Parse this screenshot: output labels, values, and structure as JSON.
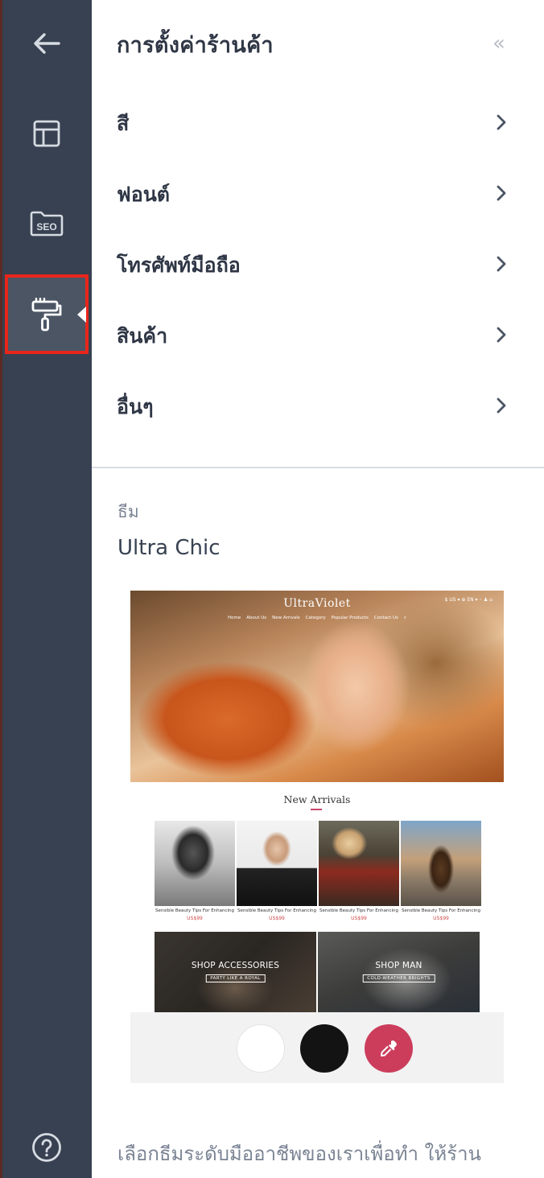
{
  "rail": {
    "items": [
      {
        "name": "back",
        "icon": "arrow-left-icon"
      },
      {
        "name": "layout",
        "icon": "layout-icon"
      },
      {
        "name": "seo",
        "icon": "seo-icon",
        "label": "SEO"
      },
      {
        "name": "design",
        "icon": "paint-roller-icon",
        "active": true
      },
      {
        "name": "help",
        "icon": "question-circle-icon"
      }
    ],
    "highlight_color": "#e8261b"
  },
  "panel": {
    "title": "การตั้งค่าร้านค้า",
    "collapse_label": "«",
    "menu": [
      {
        "label": "สี"
      },
      {
        "label": "ฟอนต์"
      },
      {
        "label": "โทรศัพท์มือถือ"
      },
      {
        "label": "สินค้า"
      },
      {
        "label": "อื่นๆ"
      }
    ]
  },
  "theme": {
    "caption": "ธีม",
    "name": "Ultra Chic",
    "preview": {
      "logo": "UltraViolet",
      "top_right": "$ US ▾   ⊕ EN ▾   ◦   ♟   ⌂",
      "nav": [
        "Home",
        "About Us",
        "New Arrivals",
        "Category",
        "Popular Products",
        "Contact Us"
      ],
      "section_title": "New Arrivals",
      "products": [
        {
          "name": "Sensible Beauty Tips For Enhancing",
          "price": "US$99"
        },
        {
          "name": "Sensible Beauty Tips For Enhancing",
          "price": "US$99"
        },
        {
          "name": "Sensible Beauty Tips For Enhancing",
          "price": "US$99"
        },
        {
          "name": "Sensible Beauty Tips For Enhancing",
          "price": "US$99"
        }
      ],
      "banners": [
        {
          "title": "SHOP ACCESSORIES",
          "subtitle": "PARTY LIKE A ROYAL"
        },
        {
          "title": "SHOP MAN",
          "subtitle": "COLD-WEATHER BRIGHTS"
        }
      ]
    },
    "swatches": [
      {
        "name": "white",
        "color": "#ffffff"
      },
      {
        "name": "black",
        "color": "#131313"
      },
      {
        "name": "custom-picker",
        "color": "#cc3d5c",
        "icon": "eyedropper-icon"
      }
    ]
  },
  "description": "เลือกธีมระดับมืออาชีพของเราเพื่อทำ ให้ร้าน"
}
